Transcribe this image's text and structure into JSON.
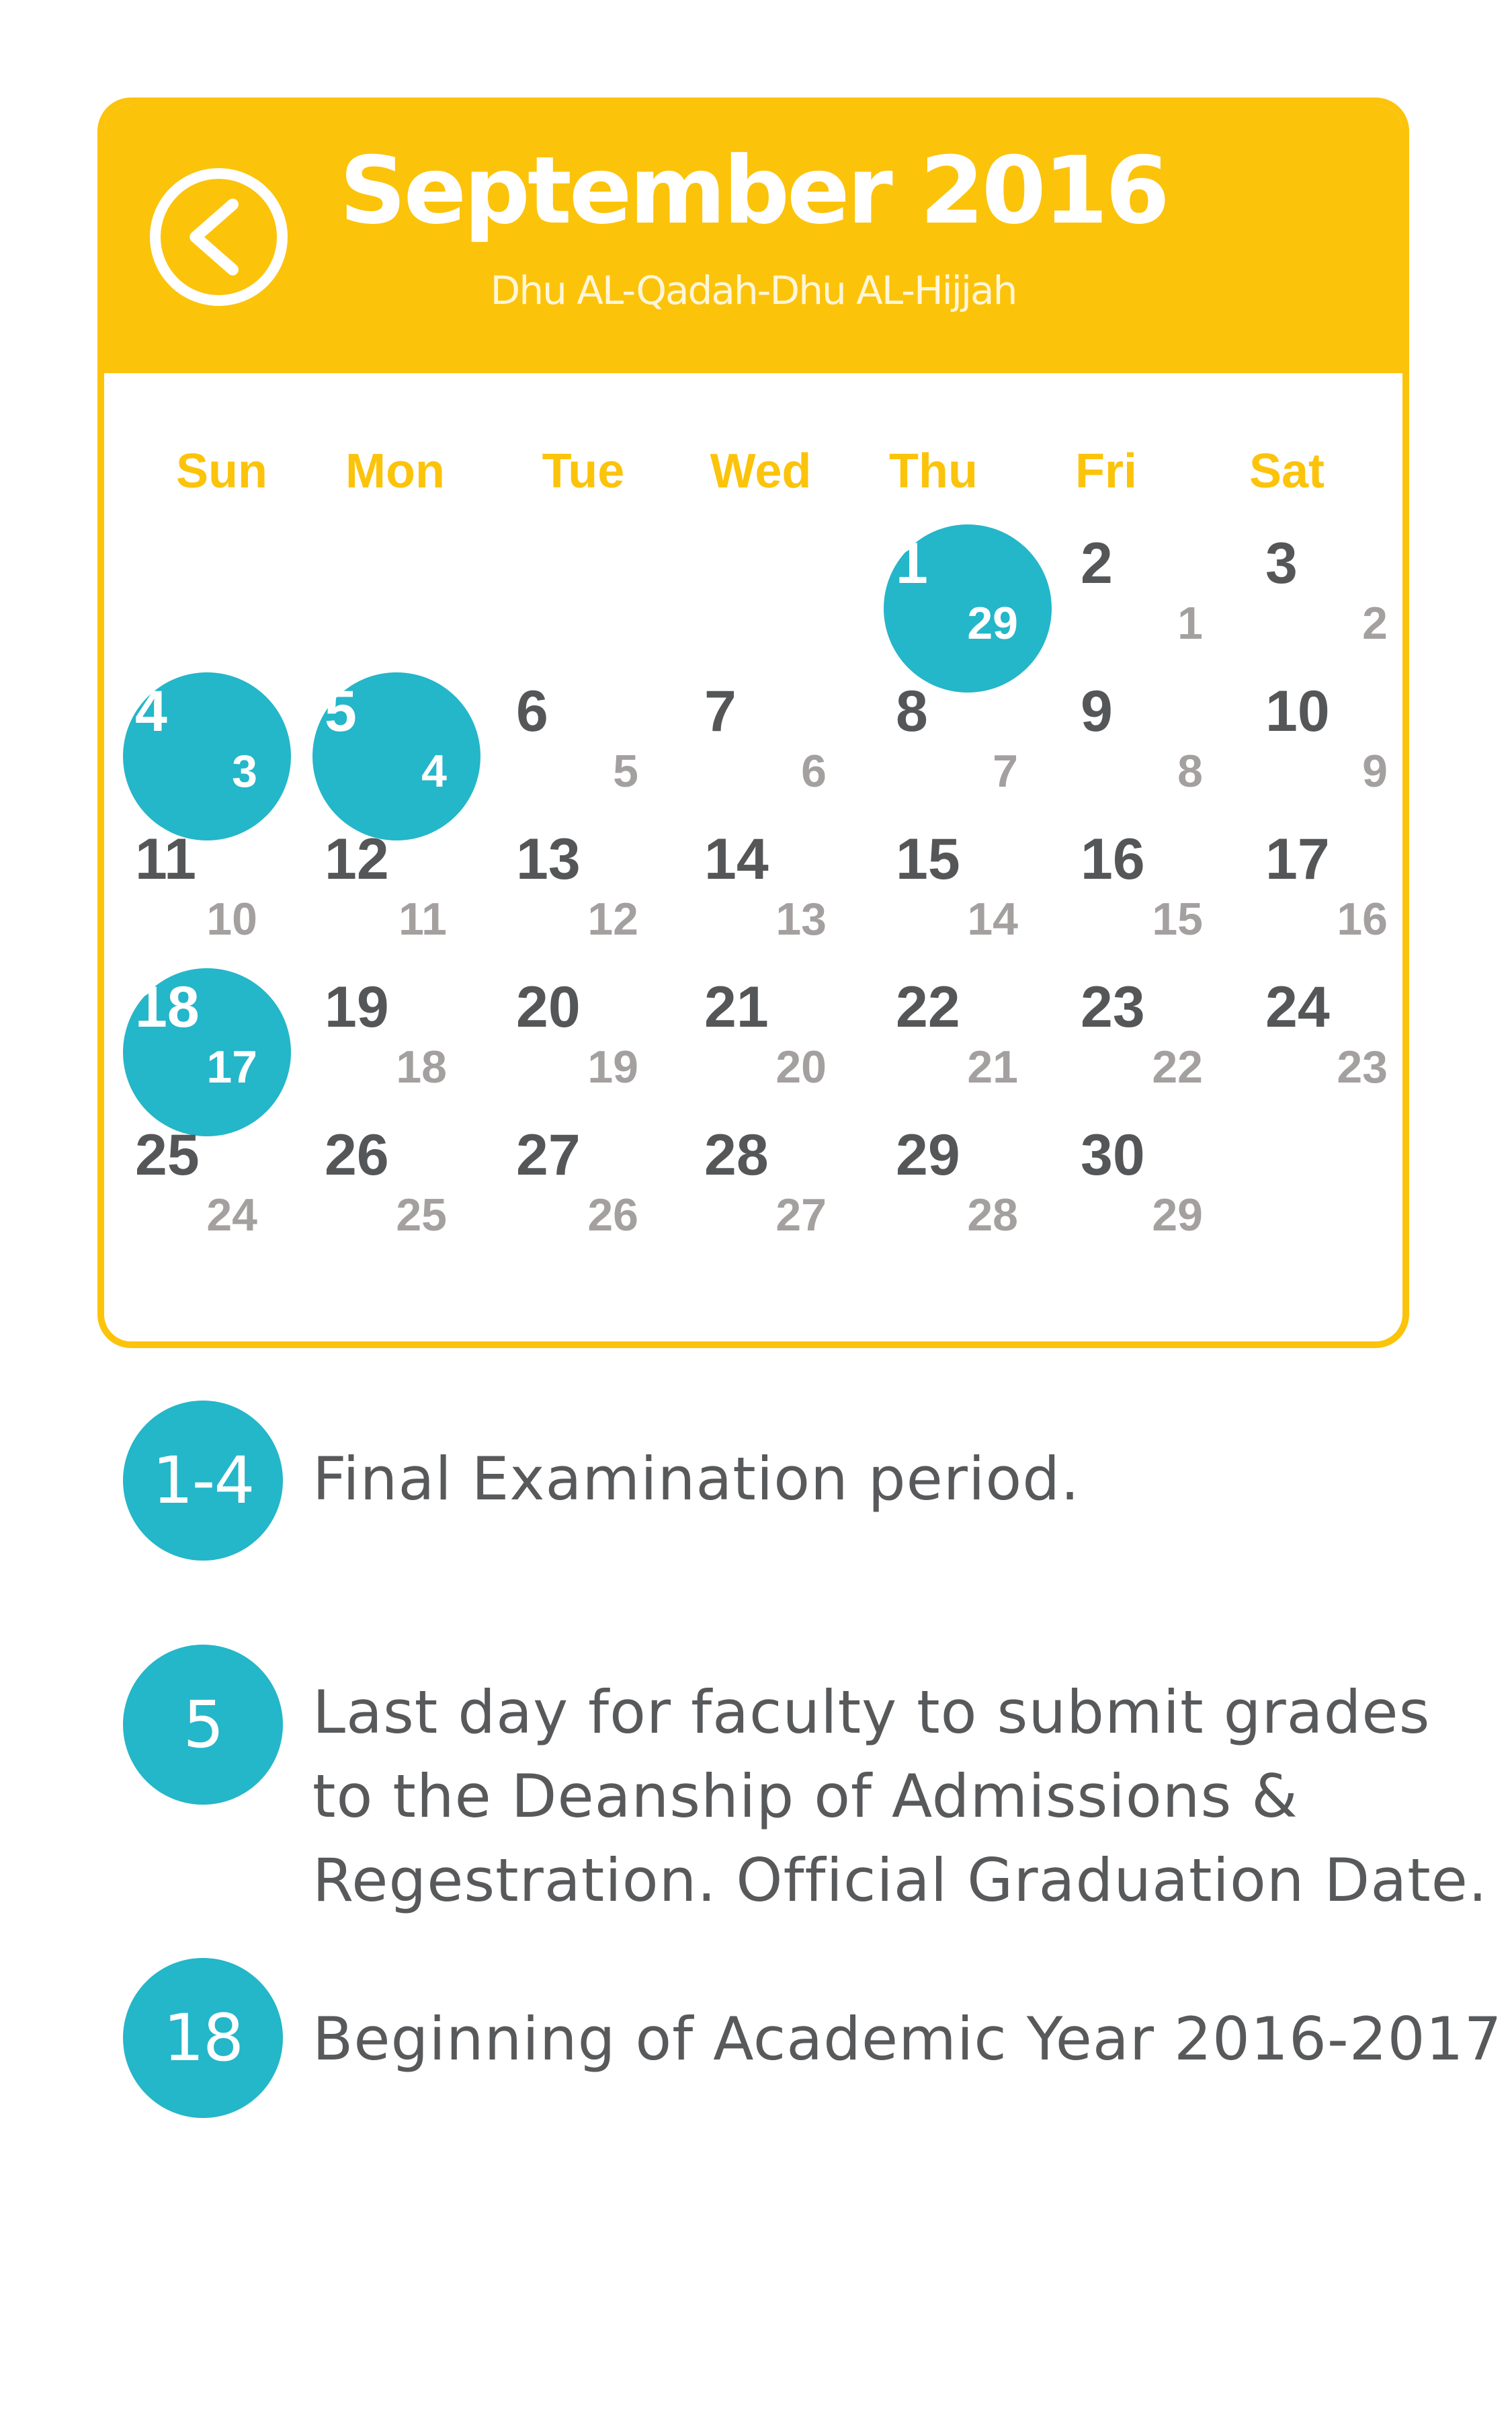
{
  "calendar": {
    "title": "September 2016",
    "subtitle": "Dhu AL-Qadah-Dhu AL-Hijjah",
    "back_icon": "chevron-left-icon",
    "weekdays": [
      "Sun",
      "Mon",
      "Tue",
      "Wed",
      "Thu",
      "Fri",
      "Sat"
    ],
    "weeks": [
      [
        null,
        null,
        null,
        null,
        {
          "day": "1",
          "hijri": "29",
          "highlight": true
        },
        {
          "day": "2",
          "hijri": "1"
        },
        {
          "day": "3",
          "hijri": "2"
        }
      ],
      [
        {
          "day": "4",
          "hijri": "3",
          "highlight": true
        },
        {
          "day": "5",
          "hijri": "4",
          "highlight": true
        },
        {
          "day": "6",
          "hijri": "5"
        },
        {
          "day": "7",
          "hijri": "6"
        },
        {
          "day": "8",
          "hijri": "7"
        },
        {
          "day": "9",
          "hijri": "8"
        },
        {
          "day": "10",
          "hijri": "9"
        }
      ],
      [
        {
          "day": "11",
          "hijri": "10"
        },
        {
          "day": "12",
          "hijri": "11"
        },
        {
          "day": "13",
          "hijri": "12"
        },
        {
          "day": "14",
          "hijri": "13"
        },
        {
          "day": "15",
          "hijri": "14"
        },
        {
          "day": "16",
          "hijri": "15"
        },
        {
          "day": "17",
          "hijri": "16"
        }
      ],
      [
        {
          "day": "18",
          "hijri": "17",
          "highlight": true
        },
        {
          "day": "19",
          "hijri": "18"
        },
        {
          "day": "20",
          "hijri": "19"
        },
        {
          "day": "21",
          "hijri": "20"
        },
        {
          "day": "22",
          "hijri": "21"
        },
        {
          "day": "23",
          "hijri": "22"
        },
        {
          "day": "24",
          "hijri": "23"
        }
      ],
      [
        {
          "day": "25",
          "hijri": "24"
        },
        {
          "day": "26",
          "hijri": "25"
        },
        {
          "day": "27",
          "hijri": "26"
        },
        {
          "day": "28",
          "hijri": "27"
        },
        {
          "day": "29",
          "hijri": "28"
        },
        {
          "day": "30",
          "hijri": "29"
        },
        null
      ]
    ]
  },
  "events": [
    {
      "badge": "1-4",
      "lines": [
        "Final Examination period."
      ]
    },
    {
      "badge": "5",
      "lines": [
        "Last day for faculty to submit grades",
        "to the Deanship of Admissions &",
        "Regestration. Official Graduation Date."
      ]
    },
    {
      "badge": "18",
      "lines": [
        "Beginning of Academic Year 2016-2017"
      ]
    }
  ],
  "colors": {
    "accent_yellow": "#fcc30b",
    "highlight_teal": "#24b6c9",
    "day_number": "#555657",
    "hijri_number": "#a3a09f",
    "event_text": "#58595b"
  }
}
